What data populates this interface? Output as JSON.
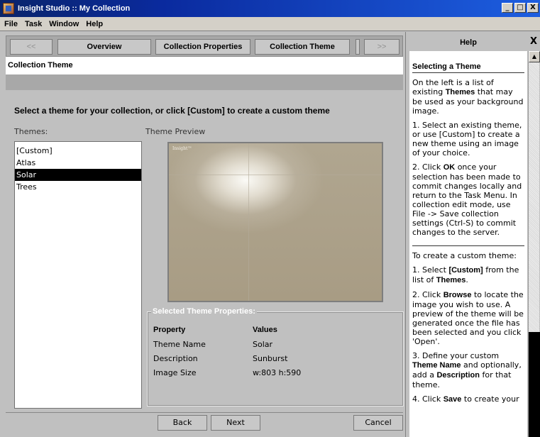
{
  "window": {
    "title": "Insight Studio :: My Collection",
    "buttons": [
      "_",
      "□",
      "X"
    ]
  },
  "menu": [
    "File",
    "Task",
    "Window",
    "Help"
  ],
  "nav": {
    "prev": "<<",
    "overview": "Overview",
    "collection_properties": "Collection Properties",
    "collection_theme": "Collection Theme",
    "next": ">>"
  },
  "section": {
    "title": "Collection Theme"
  },
  "instruction": "Select a theme for your collection, or click [Custom] to create a custom theme",
  "themes": {
    "label": "Themes:",
    "items": [
      "[Custom]",
      "Atlas",
      "Solar",
      "Trees"
    ],
    "selected_index": 2
  },
  "preview": {
    "label": "Theme Preview",
    "logo": "Insight™"
  },
  "properties": {
    "title": "Selected Theme Properties:",
    "col_property": "Property",
    "col_values": "Values",
    "rows": [
      {
        "property": "Theme Name",
        "value": "Solar"
      },
      {
        "property": "Description",
        "value": "Sunburst"
      },
      {
        "property": "Image Size",
        "value": "w:803 h:590"
      }
    ]
  },
  "footer": {
    "back": "Back",
    "next": "Next",
    "cancel": "Cancel"
  },
  "help": {
    "header": "Help",
    "close": "X",
    "title": "Selecting a Theme",
    "p1_a": "On the left is a list of existing ",
    "p1_b": "Themes",
    "p1_c": " that may be used as your background image.",
    "p2": "1. Select an existing theme, or use [Custom] to create a new theme using an image of your choice.",
    "p3_a": "2. Click ",
    "p3_b": "OK",
    "p3_c": " once your selection has been made to commit changes locally and return to the Task Menu. In collection edit mode, use File -> Save collection settings (Ctrl-S) to commit changes to the server.",
    "p4": "To create a custom theme:",
    "p5_a": "1. Select ",
    "p5_b": "[Custom]",
    "p5_c": " from the list of ",
    "p5_d": "Themes",
    "p5_e": ".",
    "p6_a": "2. Click ",
    "p6_b": "Browse",
    "p6_c": " to locate the image you wish to use. A preview of the theme will be generated once the file has been selected and you click 'Open'.",
    "p7_a": "3. Define your custom ",
    "p7_b": "Theme Name",
    "p7_c": " and optionally, add a ",
    "p7_d": "Description",
    "p7_e": " for that theme.",
    "p8_a": "4. Click ",
    "p8_b": "Save",
    "p8_c": " to create your"
  }
}
